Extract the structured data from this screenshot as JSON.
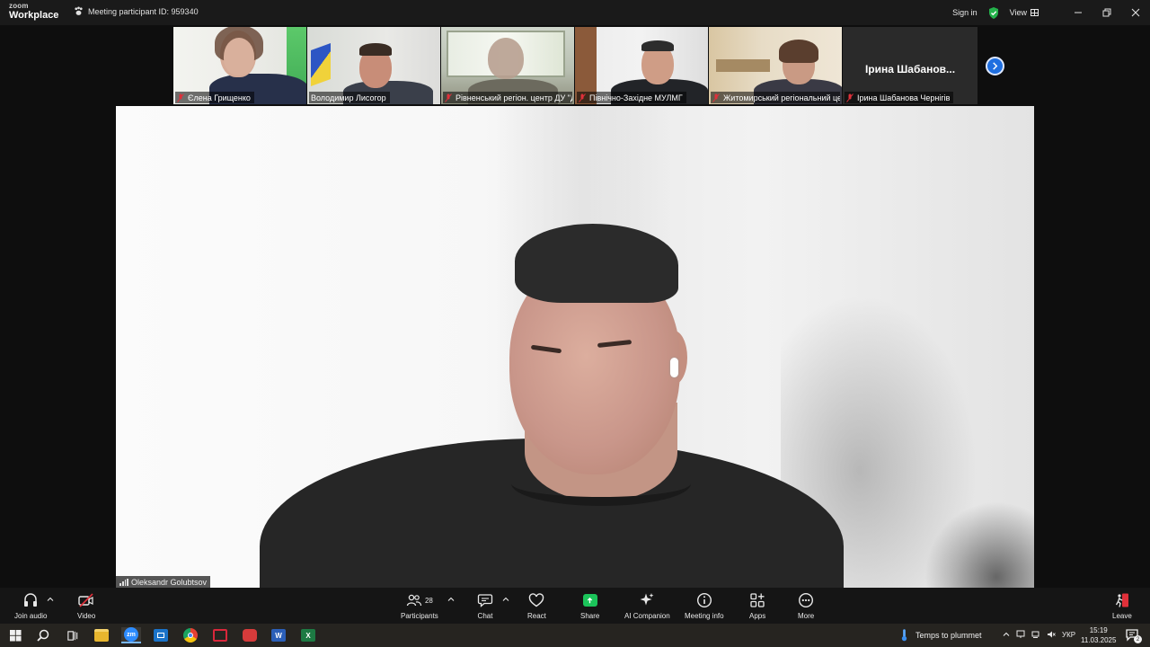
{
  "app": {
    "logo_top": "zoom",
    "logo_bottom": "Workplace",
    "meeting_id_text": "Meeting participant ID: 959340",
    "sign_in": "Sign in",
    "view": "View"
  },
  "participants_strip": [
    {
      "name": "Єлена Грищенко",
      "muted": true
    },
    {
      "name": "Володимир Лисогор",
      "muted": false
    },
    {
      "name": "Рівненський регіон. центр ДУ \"Д",
      "muted": true
    },
    {
      "name": "Північно-Західне МУЛМГ",
      "muted": true
    },
    {
      "name": "Житомирський регіональний це...",
      "muted": true
    },
    {
      "name": "Ірина Шабанова Чернігів",
      "muted": true,
      "display_name": "Ірина  Шабанов..."
    }
  ],
  "active_speaker": {
    "name": "Oleksandr Golubtsov"
  },
  "toolbar": {
    "join_audio": "Join audio",
    "video": "Video",
    "participants": "Participants",
    "participants_count": "28",
    "chat": "Chat",
    "react": "React",
    "share": "Share",
    "ai_companion": "AI Companion",
    "meeting_info": "Meeting info",
    "apps": "Apps",
    "more": "More",
    "leave": "Leave"
  },
  "taskbar": {
    "weather": "Temps to plummet",
    "language": "УКР",
    "time": "15:19",
    "date": "11.03.2025",
    "notifications": "2",
    "apps": [
      {
        "name": "File Explorer",
        "label": "",
        "color": "#e8b62e"
      },
      {
        "name": "Zoom",
        "label": "zm",
        "color": "#2d8cff"
      },
      {
        "name": "Outlook",
        "label": "",
        "color": "#1a73c9"
      },
      {
        "name": "Chrome",
        "label": "",
        "color": "#e34133"
      },
      {
        "name": "Screenshot",
        "label": "",
        "color": "#d9273b"
      },
      {
        "name": "Other",
        "label": "",
        "color": "#d63b3b"
      },
      {
        "name": "Word",
        "label": "W",
        "color": "#2b5fb8"
      },
      {
        "name": "Excel",
        "label": "X",
        "color": "#1d7a43"
      }
    ]
  },
  "colors": {
    "accent_blue": "#1f6fe0",
    "share_green": "#1bc45a",
    "muted_red": "#e0303a",
    "shield_green": "#24b24b"
  }
}
